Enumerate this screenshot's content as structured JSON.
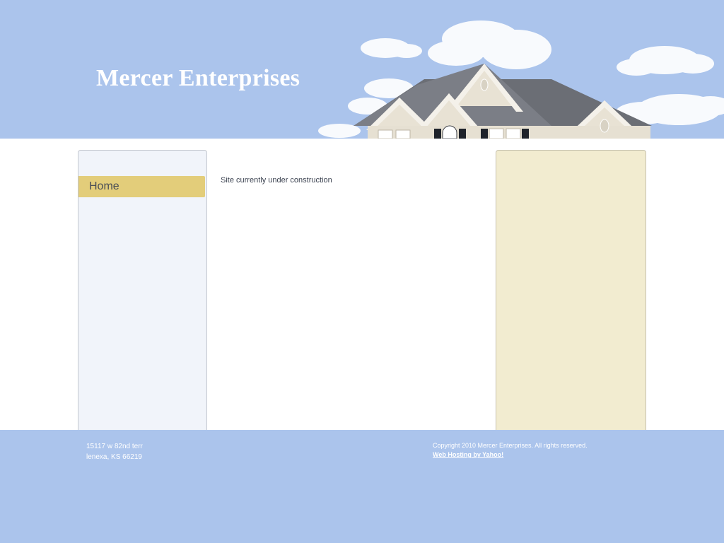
{
  "header": {
    "site_title": "Mercer Enterprises"
  },
  "nav": {
    "items": [
      {
        "label": "Home"
      }
    ]
  },
  "main": {
    "text": "Site currently under construction"
  },
  "footer": {
    "address_line1": "15117 w 82nd terr",
    "address_line2": "lenexa, KS 66219",
    "copyright": "Copyright 2010 Mercer Enterprises. All rights reserved.",
    "hosting_link": "Web Hosting by Yahoo!"
  },
  "colors": {
    "sky": "#abc4ec",
    "nav_panel": "#f1f4fa",
    "nav_active": "#e3cd7a",
    "side_panel": "#f2ecd0",
    "title_text": "#ffffff"
  }
}
